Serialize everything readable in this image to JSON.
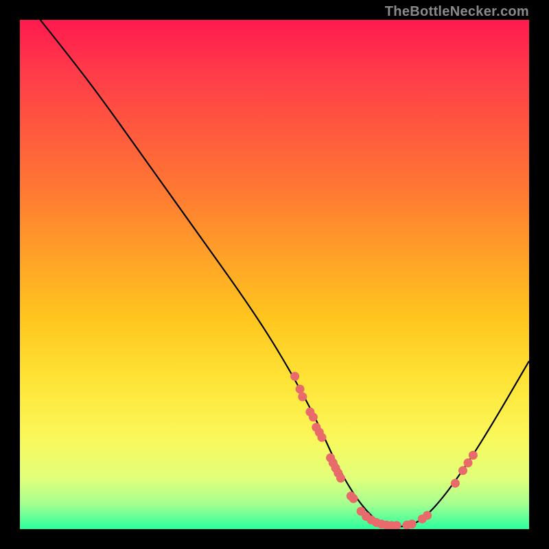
{
  "attribution": "TheBottleNecker.com",
  "colors": {
    "background": "#000000",
    "dot": "#e86a6a",
    "curve": "#000000"
  },
  "chart_data": {
    "type": "line",
    "title": "",
    "xlabel": "",
    "ylabel": "",
    "xlim": [
      0,
      100
    ],
    "ylim": [
      0,
      100
    ],
    "curve_points": [
      {
        "x": 4,
        "y": 100
      },
      {
        "x": 8,
        "y": 95
      },
      {
        "x": 15,
        "y": 86
      },
      {
        "x": 25,
        "y": 72
      },
      {
        "x": 35,
        "y": 58
      },
      {
        "x": 45,
        "y": 44
      },
      {
        "x": 52,
        "y": 33
      },
      {
        "x": 58,
        "y": 22
      },
      {
        "x": 62,
        "y": 13
      },
      {
        "x": 66,
        "y": 6
      },
      {
        "x": 70,
        "y": 1.5
      },
      {
        "x": 73,
        "y": 0.5
      },
      {
        "x": 76,
        "y": 0.5
      },
      {
        "x": 79,
        "y": 1.8
      },
      {
        "x": 83,
        "y": 6
      },
      {
        "x": 88,
        "y": 13
      },
      {
        "x": 93,
        "y": 21
      },
      {
        "x": 100,
        "y": 33
      }
    ],
    "series": [
      {
        "name": "scatter-points",
        "points": [
          {
            "x": 54,
            "y": 30
          },
          {
            "x": 55,
            "y": 27.5
          },
          {
            "x": 55.5,
            "y": 26
          },
          {
            "x": 57,
            "y": 23
          },
          {
            "x": 57.6,
            "y": 22
          },
          {
            "x": 58.2,
            "y": 20
          },
          {
            "x": 58.8,
            "y": 19
          },
          {
            "x": 59.3,
            "y": 18
          },
          {
            "x": 61,
            "y": 14
          },
          {
            "x": 61.5,
            "y": 13
          },
          {
            "x": 62,
            "y": 12
          },
          {
            "x": 62.5,
            "y": 11
          },
          {
            "x": 63,
            "y": 10
          },
          {
            "x": 65,
            "y": 6.5
          },
          {
            "x": 65.5,
            "y": 6
          },
          {
            "x": 67,
            "y": 3.5
          },
          {
            "x": 68,
            "y": 2.5
          },
          {
            "x": 69,
            "y": 1.8
          },
          {
            "x": 70,
            "y": 1.3
          },
          {
            "x": 71,
            "y": 1
          },
          {
            "x": 72,
            "y": 0.8
          },
          {
            "x": 73,
            "y": 0.7
          },
          {
            "x": 74,
            "y": 0.7
          },
          {
            "x": 76,
            "y": 0.8
          },
          {
            "x": 77,
            "y": 1
          },
          {
            "x": 79,
            "y": 2
          },
          {
            "x": 80,
            "y": 2.7
          },
          {
            "x": 85.5,
            "y": 9
          },
          {
            "x": 87,
            "y": 11.5
          },
          {
            "x": 88,
            "y": 13
          },
          {
            "x": 89,
            "y": 14.5
          }
        ]
      }
    ]
  }
}
